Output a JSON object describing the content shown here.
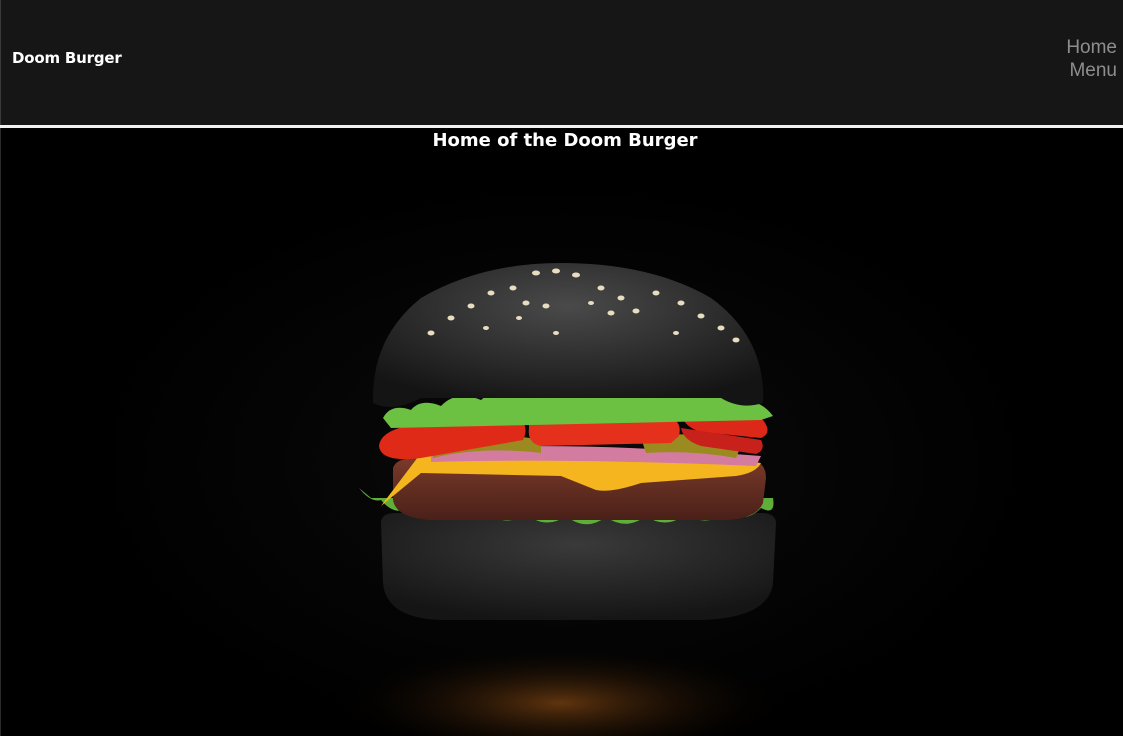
{
  "header": {
    "brand": "Doom Burger",
    "nav": [
      {
        "label": "Home"
      },
      {
        "label": "Menu"
      }
    ]
  },
  "hero": {
    "title": "Home of the Doom Burger"
  }
}
